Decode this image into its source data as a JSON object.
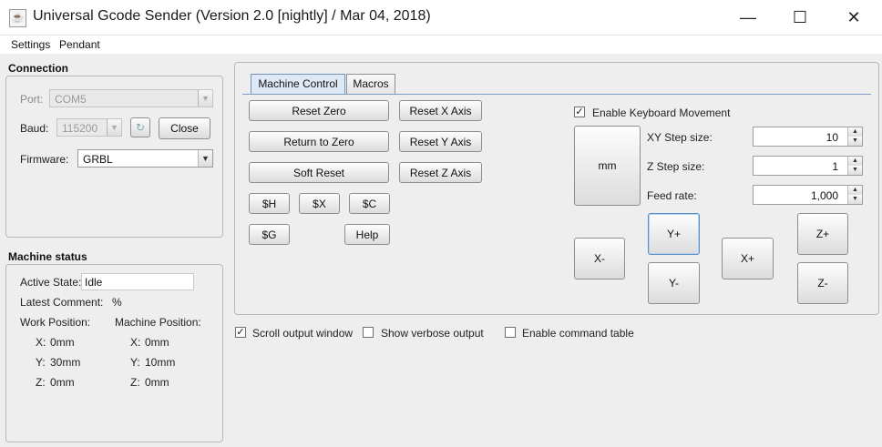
{
  "window": {
    "title": "Universal Gcode Sender (Version 2.0 [nightly]  / Mar 04, 2018)",
    "icon": "java-cup-icon",
    "controls": {
      "minimize": "—",
      "maximize": "☐",
      "close": "✕"
    }
  },
  "menu": {
    "items": [
      "Settings",
      "Pendant"
    ]
  },
  "connection": {
    "title": "Connection",
    "port_label": "Port:",
    "port_value": "COM5",
    "baud_label": "Baud:",
    "baud_value": "115200",
    "refresh_icon": "refresh-icon",
    "close_button": "Close",
    "firmware_label": "Firmware:",
    "firmware_value": "GRBL"
  },
  "machine_status": {
    "title": "Machine status",
    "active_state_label": "Active State:",
    "active_state_value": "Idle",
    "latest_comment_label": "Latest Comment:",
    "latest_comment_value": "%",
    "work_position_label": "Work Position:",
    "machine_position_label": "Machine Position:",
    "work": {
      "x_label": "X:",
      "x_value": "0mm",
      "y_label": "Y:",
      "y_value": "30mm",
      "z_label": "Z:",
      "z_value": "0mm"
    },
    "machine": {
      "x_label": "X:",
      "x_value": "0mm",
      "y_label": "Y:",
      "y_value": "10mm",
      "z_label": "Z:",
      "z_value": "0mm"
    }
  },
  "tabs": {
    "machine_control": "Machine Control",
    "macros": "Macros",
    "active": "Machine Control"
  },
  "machine_control": {
    "reset_zero": "Reset Zero",
    "return_to_zero": "Return to Zero",
    "soft_reset": "Soft Reset",
    "reset_x_axis": "Reset X Axis",
    "reset_y_axis": "Reset Y Axis",
    "reset_z_axis": "Reset Z Axis",
    "cmd_h": "$H",
    "cmd_x": "$X",
    "cmd_c": "$C",
    "cmd_g": "$G",
    "help": "Help"
  },
  "jog": {
    "enable_keyboard_label": "Enable Keyboard Movement",
    "enable_keyboard_checked": true,
    "units_button": "mm",
    "xy_step_label": "XY Step size:",
    "xy_step_value": "10",
    "z_step_label": "Z Step size:",
    "z_step_value": "1",
    "feed_rate_label": "Feed rate:",
    "feed_rate_value": "1,000",
    "x_minus": "X-",
    "x_plus": "X+",
    "y_plus": "Y+",
    "y_minus": "Y-",
    "z_plus": "Z+",
    "z_minus": "Z-"
  },
  "output_options": {
    "scroll_output_label": "Scroll output window",
    "scroll_output_checked": true,
    "verbose_label": "Show verbose output",
    "verbose_checked": false,
    "command_table_label": "Enable command table",
    "command_table_checked": false
  }
}
